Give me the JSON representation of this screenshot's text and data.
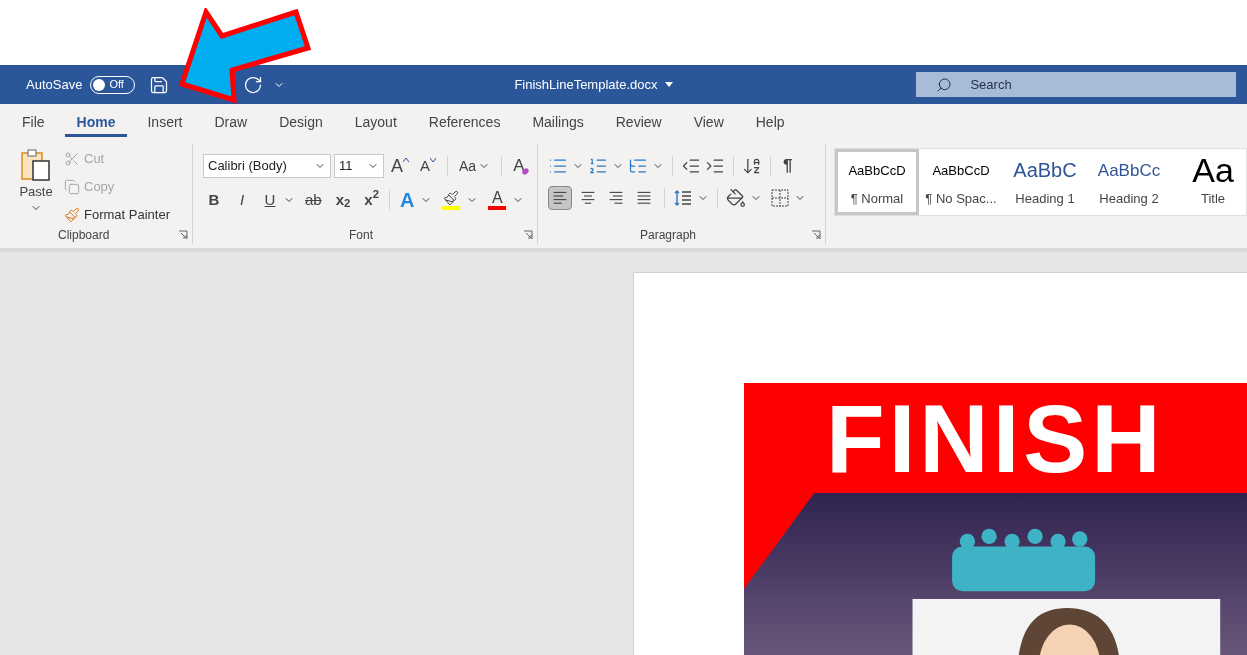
{
  "quick_access": {
    "autosave_label": "AutoSave",
    "toggle_label": "Off",
    "on": false
  },
  "document_title": "FinishLineTemplate.docx",
  "search": {
    "placeholder": "Search"
  },
  "tabs": [
    {
      "label": "File",
      "selected": false
    },
    {
      "label": "Home",
      "selected": true
    },
    {
      "label": "Insert",
      "selected": false
    },
    {
      "label": "Draw",
      "selected": false
    },
    {
      "label": "Design",
      "selected": false
    },
    {
      "label": "Layout",
      "selected": false
    },
    {
      "label": "References",
      "selected": false
    },
    {
      "label": "Mailings",
      "selected": false
    },
    {
      "label": "Review",
      "selected": false
    },
    {
      "label": "View",
      "selected": false
    },
    {
      "label": "Help",
      "selected": false
    }
  ],
  "clipboard": {
    "paste_label": "Paste",
    "group_label": "Clipboard",
    "items": [
      {
        "kind": "cut",
        "label": "Cut",
        "disabled": true
      },
      {
        "kind": "copy",
        "label": "Copy",
        "disabled": true
      },
      {
        "kind": "format_painter",
        "label": "Format Painter",
        "disabled": false
      }
    ]
  },
  "font": {
    "group_label": "Font",
    "font_name": "Calibri (Body)",
    "font_size": "11",
    "grow_label": "A",
    "shrink_label": "A",
    "case_label": "Aa",
    "clear_label": "A",
    "formats": [
      {
        "kind": "bold",
        "label": "B"
      },
      {
        "kind": "italic",
        "label": "I"
      },
      {
        "kind": "underline",
        "label": "U"
      },
      {
        "kind": "strike",
        "label": "ab"
      },
      {
        "kind": "sub",
        "label": "x$_{2}$"
      },
      {
        "kind": "sup",
        "label": "x$^{2}$"
      }
    ],
    "colors": [
      {
        "kind": "effects",
        "label": "A",
        "color": "#1e88e5"
      },
      {
        "kind": "highlight",
        "color": "#ffff00"
      },
      {
        "kind": "font_color",
        "label": "A",
        "color": "#ff0000"
      }
    ]
  },
  "paragraph": {
    "group_label": "Paragraph",
    "marks_label": "¶",
    "alignments": [
      {
        "kind": "left",
        "selected": true
      },
      {
        "kind": "center",
        "selected": false
      },
      {
        "kind": "right",
        "selected": false
      },
      {
        "kind": "justify",
        "selected": false
      }
    ]
  },
  "styles": [
    {
      "kind": "normal",
      "preview": "AaBbCcD",
      "name": "¶ Normal",
      "selected": true
    },
    {
      "kind": "normal",
      "preview": "AaBbCcD",
      "name": "¶ No Spac...",
      "selected": false
    },
    {
      "kind": "heading1",
      "preview": "AaBbC",
      "name": "Heading 1",
      "selected": false
    },
    {
      "kind": "heading2",
      "preview": "AaBbCc",
      "name": "Heading 2",
      "selected": false
    },
    {
      "kind": "title",
      "preview": "Aa",
      "name": "Title",
      "selected": false
    }
  ],
  "document": {
    "heading": "FINISH"
  }
}
